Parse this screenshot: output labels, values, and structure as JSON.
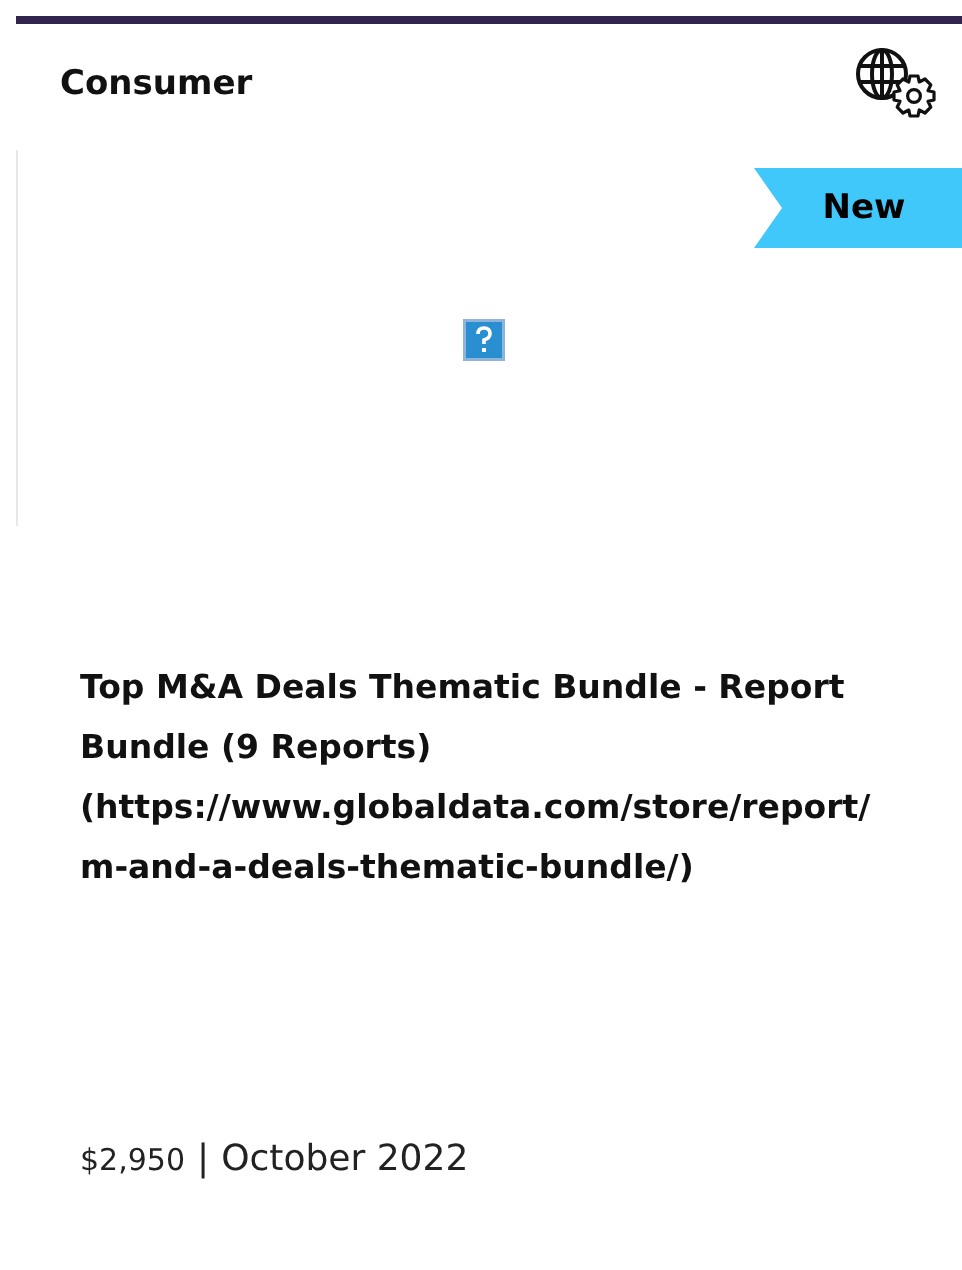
{
  "category": "Consumer",
  "image": {
    "badge": "New",
    "broken": true
  },
  "title": "Top M&A Deals Thematic Bundle - Report\nBundle (9 Reports)\n(https://www.globaldata.com/store/report/\nm-and-a-deals-thematic-bundle/)",
  "price": "$2,950",
  "separator": "|",
  "date": "October 2022"
}
